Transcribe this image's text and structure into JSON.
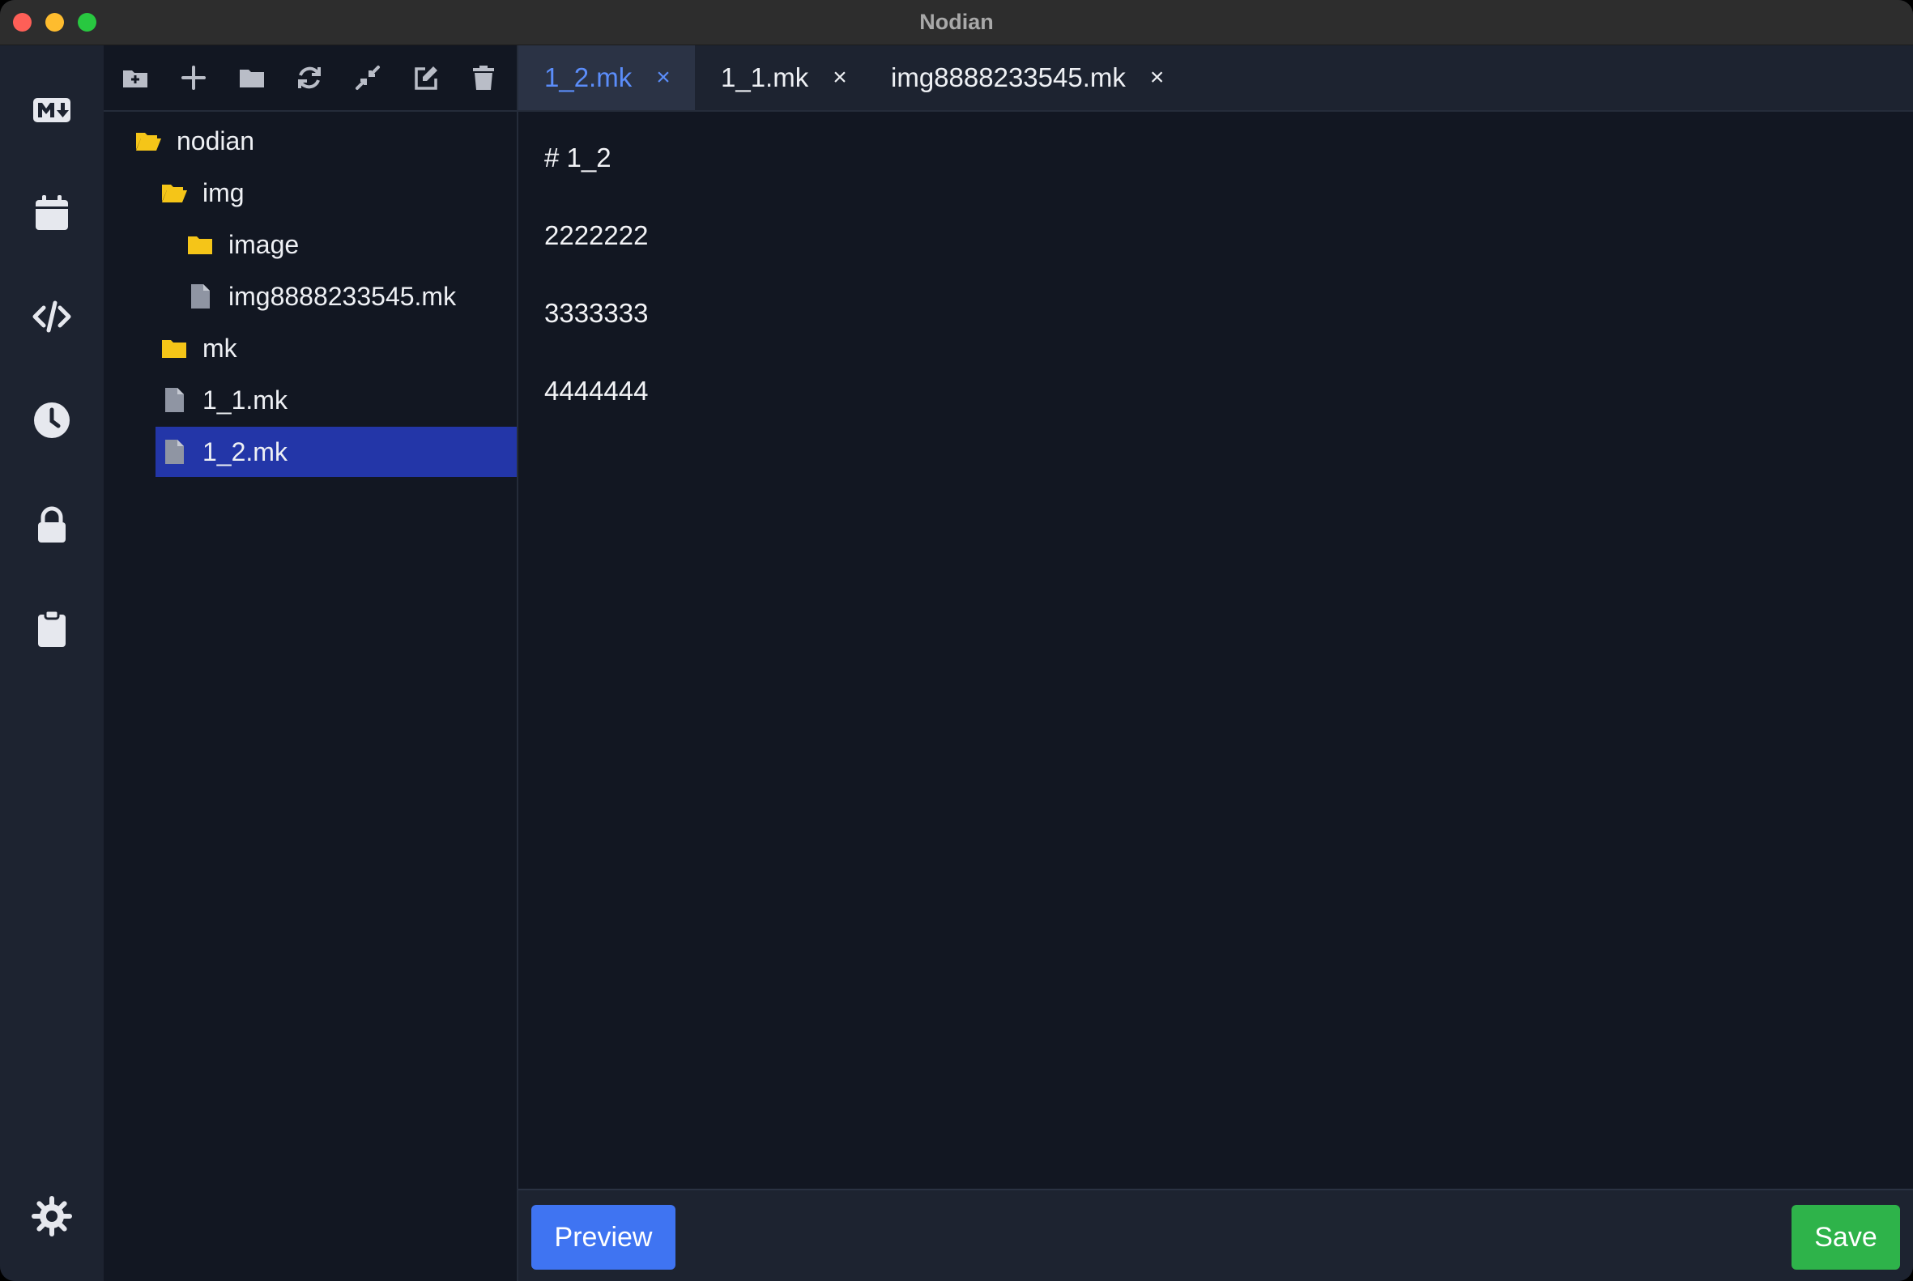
{
  "window": {
    "title": "Nodian"
  },
  "activity_bar": {
    "items": [
      {
        "icon": "markdown-icon"
      },
      {
        "icon": "calendar-icon"
      },
      {
        "icon": "code-icon"
      },
      {
        "icon": "clock-icon"
      },
      {
        "icon": "lock-icon"
      },
      {
        "icon": "clipboard-icon"
      }
    ],
    "bottom": {
      "icon": "settings-icon"
    }
  },
  "explorer": {
    "toolbar": [
      "new-folder-icon",
      "plus-icon",
      "folder-icon",
      "refresh-icon",
      "collapse-icon",
      "edit-icon",
      "trash-icon"
    ],
    "tree": [
      {
        "label": "nodian",
        "type": "folder-open",
        "depth": 0
      },
      {
        "label": "img",
        "type": "folder-open",
        "depth": 1
      },
      {
        "label": "image",
        "type": "folder",
        "depth": 2
      },
      {
        "label": "img8888233545.mk",
        "type": "file",
        "depth": 2
      },
      {
        "label": "mk",
        "type": "folder",
        "depth": 1
      },
      {
        "label": "1_1.mk",
        "type": "file",
        "depth": 1
      },
      {
        "label": "1_2.mk",
        "type": "file",
        "depth": 1,
        "selected": true
      }
    ]
  },
  "tabs": [
    {
      "label": "1_2.mk",
      "close": "×",
      "active": true
    },
    {
      "label": "1_1.mk",
      "close": "×",
      "active": false
    },
    {
      "label": "img8888233545.mk",
      "close": "×",
      "active": false
    }
  ],
  "editor": {
    "lines": [
      "# 1_2",
      "2222222",
      "3333333",
      "4444444"
    ]
  },
  "footer": {
    "preview_label": "Preview",
    "save_label": "Save"
  },
  "colors": {
    "accent": "#3f74f2",
    "save": "#2eb34a",
    "selection": "#2336a8",
    "folder": "#f5c518",
    "active_tab_text": "#5b8dfa"
  }
}
